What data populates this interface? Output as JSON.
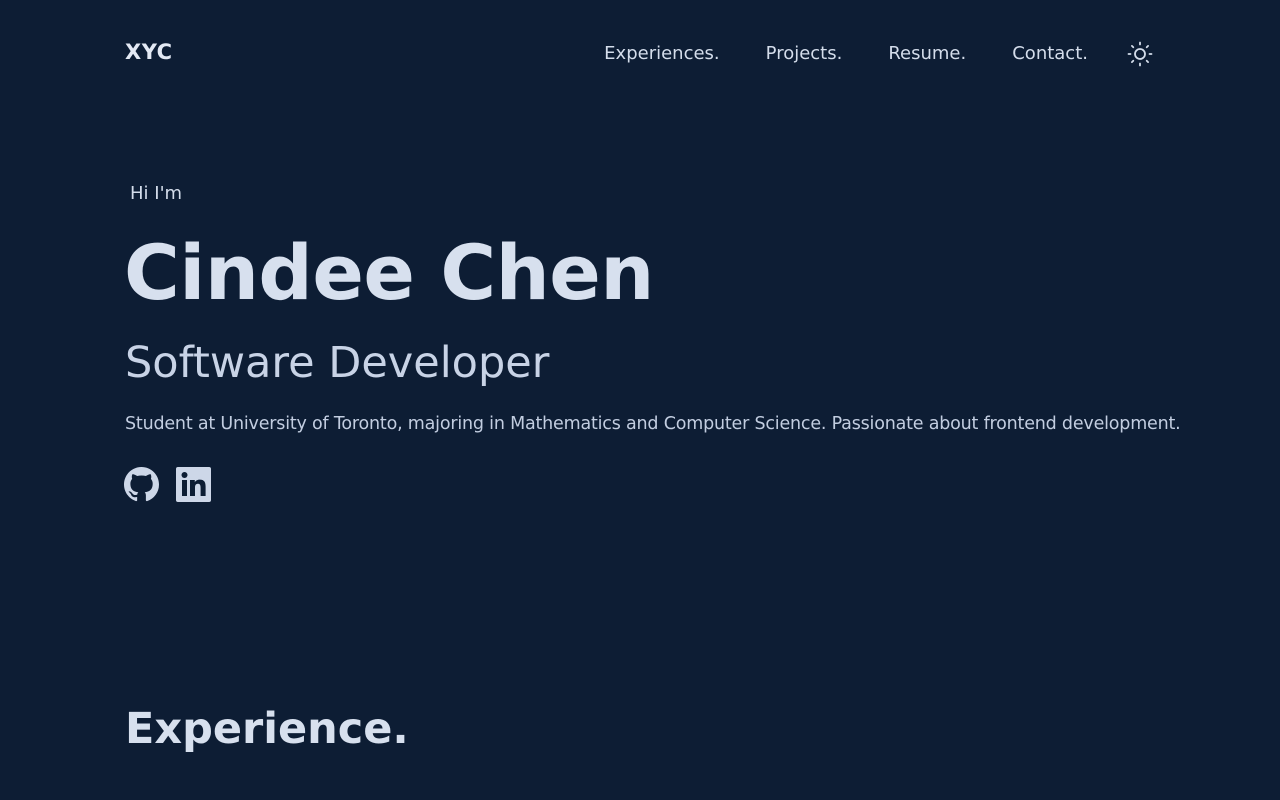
{
  "header": {
    "logo": "XYC",
    "nav": [
      {
        "label": "Experiences."
      },
      {
        "label": "Projects."
      },
      {
        "label": "Resume."
      },
      {
        "label": "Contact."
      }
    ],
    "theme_icon": "sun-icon"
  },
  "hero": {
    "greeting": "Hi I'm",
    "name": "Cindee Chen",
    "role": "Software Developer",
    "bio": "Student at University of Toronto, majoring in Mathematics and Computer Science. Passionate about frontend development.",
    "socials": [
      {
        "icon": "github-icon"
      },
      {
        "icon": "linkedin-icon"
      }
    ]
  },
  "experience": {
    "heading": "Experience."
  },
  "colors": {
    "background": "#0d1d34",
    "text": "#d7e0ee"
  }
}
